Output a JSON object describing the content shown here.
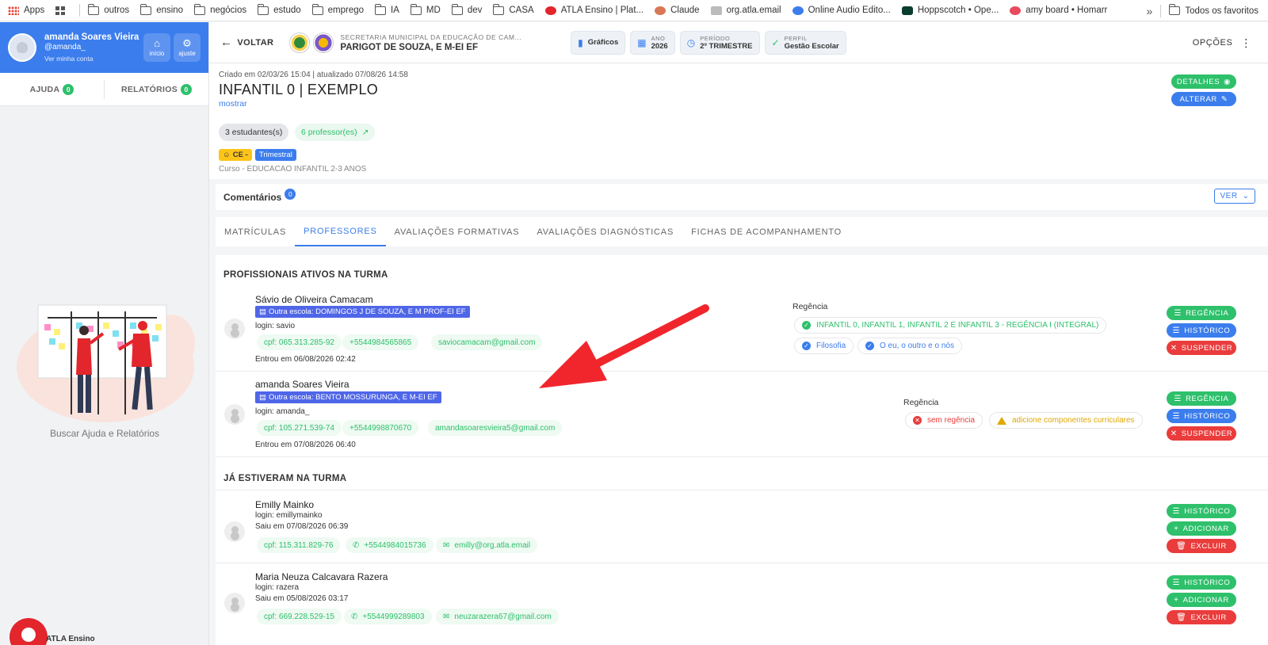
{
  "bookmarks": [
    {
      "label": "Apps",
      "icon": "apps-icon"
    },
    {
      "label": "",
      "icon": "grid-icon"
    },
    {
      "label": "outros",
      "icon": "folder-icon"
    },
    {
      "label": "ensino",
      "icon": "folder-icon"
    },
    {
      "label": "negócios",
      "icon": "folder-icon"
    },
    {
      "label": "estudo",
      "icon": "folder-icon"
    },
    {
      "label": "emprego",
      "icon": "folder-icon"
    },
    {
      "label": "IA",
      "icon": "folder-icon"
    },
    {
      "label": "MD",
      "icon": "folder-icon"
    },
    {
      "label": "dev",
      "icon": "folder-icon"
    },
    {
      "label": "CASA",
      "icon": "folder-icon"
    },
    {
      "label": "ATLA Ensino | Plat...",
      "icon": "site-icon",
      "color": "#e2262c"
    },
    {
      "label": "Claude",
      "icon": "site-icon",
      "color": "#d97757"
    },
    {
      "label": "org.atla.email",
      "icon": "site-icon",
      "color": "#bbbbbb"
    },
    {
      "label": "Online Audio Edito...",
      "icon": "site-icon",
      "color": "#3b7ded"
    },
    {
      "label": "Hoppscotch • Ope...",
      "icon": "site-icon",
      "color": "#0b3d2e"
    },
    {
      "label": "amy board • Homarr",
      "icon": "site-icon",
      "color": "#e84a5f"
    }
  ],
  "bookmarks_more": "»",
  "bookmarks_all": "Todos os favoritos",
  "user": {
    "name": "amanda Soares Vieira",
    "handle": "@amanda_",
    "link": "Ver minha conta",
    "home_label": "início",
    "settings_label": "ajuste"
  },
  "help": {
    "ajuda_label": "AJUDA",
    "ajuda_count": "0",
    "relatorios_label": "RELATÓRIOS",
    "relatorios_count": "0",
    "caption": "Buscar Ajuda e Relatórios",
    "brand": "ATLA Ensino"
  },
  "topbar": {
    "back_label": "VOLTAR",
    "school_sub": "SECRETARIA MUNICIPAL DA EDUCAÇÃO DE CAM...",
    "school_name": "PARIGOT DE SOUZA, E M-EI EF",
    "chips": [
      {
        "l1": "",
        "l2": "Gráficos",
        "icon": "chart-icon"
      },
      {
        "l1": "ANO",
        "l2": "2026",
        "icon": "calendar-icon"
      },
      {
        "l1": "PERÍODO",
        "l2": "2º TRIMESTRE",
        "icon": "clock-icon"
      },
      {
        "l1": "PERFIL",
        "l2": "Gestão Escolar",
        "icon": "check-circle-icon"
      }
    ],
    "options_label": "OPÇÕES"
  },
  "classinfo": {
    "meta": "Criado em 02/03/26 15:04 | atualizado 07/08/26 14:58",
    "title": "INFANTIL 0 | EXEMPLO",
    "show_link": "mostrar",
    "students": "3 estudantes(s)",
    "teachers": "6 professor(es)",
    "tag_ce": "CE -",
    "tag_period": "Trimestral",
    "course": "Curso - EDUCACAO INFANTIL 2-3 ANOS",
    "details_label": "DETALHES",
    "alter_label": "ALTERAR"
  },
  "comments": {
    "title": "Comentários",
    "count": "0",
    "ver_label": "VER"
  },
  "tabs": [
    {
      "label": "MATRÍCULAS",
      "active": false
    },
    {
      "label": "PROFESSORES",
      "active": true
    },
    {
      "label": "AVALIAÇÕES FORMATIVAS",
      "active": false
    },
    {
      "label": "AVALIAÇÕES DIAGNÓSTICAS",
      "active": false
    },
    {
      "label": "FICHAS DE ACOMPANHAMENTO",
      "active": false
    }
  ],
  "active_section": "PROFISSIONAIS ATIVOS NA TURMA",
  "former_section": "JÁ ESTIVERAM NA TURMA",
  "active_professionals": [
    {
      "name": "Sávio de Oliveira Camacam",
      "school": "Outra escola: DOMINGOS J DE SOUZA, E M PROF-EI EF",
      "login": "login: savio",
      "cpf": "cpf: 065.313.285-92",
      "phone": "+5544984565865",
      "email": "saviocamacam@gmail.com",
      "entered": "Entrou em 06/08/2026 02:42",
      "regencia_label": "Regência",
      "regencia": [
        {
          "text": "INFANTIL 0, INFANTIL 1, INFANTIL 2 E INFANTIL 3 - REGÊNCIA I (INTEGRAL)",
          "kind": "green"
        },
        {
          "text": "Filosofia",
          "kind": "blue"
        },
        {
          "text": "O eu, o outro e o nós",
          "kind": "blue"
        }
      ],
      "actions": [
        "REGÊNCIA",
        "HISTÓRICO",
        "SUSPENDER"
      ]
    },
    {
      "name": "amanda Soares Vieira",
      "school": "Outra escola: BENTO MOSSURUNGA, E M-EI EF",
      "login": "login: amanda_",
      "cpf": "cpf: 105.271.539-74",
      "phone": "+5544998870670",
      "email": "amandasoaresvieira5@gmail.com",
      "entered": "Entrou em 07/08/2026 06:40",
      "regencia_label": "Regência",
      "regencia": [
        {
          "text": "sem regência",
          "kind": "red"
        },
        {
          "text": "adicione componentes curriculares",
          "kind": "warn"
        }
      ],
      "actions": [
        "REGÊNCIA",
        "HISTÓRICO",
        "SUSPENDER"
      ]
    }
  ],
  "former_professionals": [
    {
      "name": "Emilly Mainko",
      "login": "login: emillymainko",
      "left": "Saiu em 07/08/2026 06:39",
      "cpf": "cpf: 115.311.829-76",
      "phone": "+5544984015736",
      "email": "emilly@org.atla.email",
      "actions": [
        "HISTÓRICO",
        "ADICIONAR",
        "EXCLUIR"
      ]
    },
    {
      "name": "Maria Neuza Calcavara Razera",
      "login": "login: razera",
      "left": "Saiu em 05/08/2026 03:17",
      "cpf": "cpf: 669.228.529-15",
      "phone": "+5544999289803",
      "email": "neuzarazera67@gmail.com",
      "actions": [
        "HISTÓRICO",
        "ADICIONAR",
        "EXCLUIR"
      ]
    }
  ],
  "colors": {
    "primary": "#3b7ded",
    "success": "#2ec06b",
    "danger": "#ea3c3c",
    "warning": "#e0a800",
    "school_tag": "#4f66e8",
    "annotation_arrow": "#f0262c"
  }
}
